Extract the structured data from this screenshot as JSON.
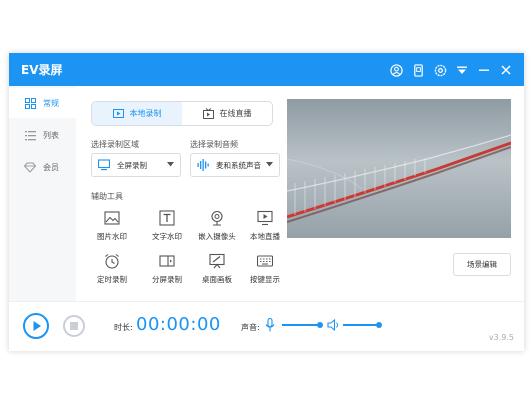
{
  "app": {
    "title": "EV录屏"
  },
  "titlebar_icons": [
    "user-icon",
    "tablet-icon",
    "settings-icon",
    "dropdown-menu-icon",
    "minimize-icon",
    "close-icon"
  ],
  "sidebar": {
    "items": [
      {
        "label": "常规",
        "icon": "grid-icon",
        "active": true
      },
      {
        "label": "列表",
        "icon": "list-icon",
        "active": false
      },
      {
        "label": "会员",
        "icon": "diamond-icon",
        "active": false
      }
    ]
  },
  "tabs": [
    {
      "label": "本地录制",
      "active": true
    },
    {
      "label": "在线直播",
      "active": false
    }
  ],
  "record_area": {
    "label": "选择录制区域",
    "value": "全屏录制"
  },
  "record_audio": {
    "label": "选择录制音频",
    "value": "麦和系统声音"
  },
  "tools": {
    "label": "辅助工具",
    "items": [
      "图片水印",
      "文字水印",
      "嵌入摄像头",
      "本地直播",
      "定时录制",
      "分屏录制",
      "桌面画板",
      "按键显示"
    ]
  },
  "scene_button": "场景编辑",
  "bottom": {
    "duration_label": "时长:",
    "timer": "00:00:00",
    "volume_label": "声音:",
    "mic_level": 1.0,
    "speaker_level": 1.0,
    "version": "v3.9.5"
  },
  "colors": {
    "accent": "#1c94f3",
    "sidebar_bg": "#f6f7f9",
    "rail_track": "#d8dde3"
  }
}
